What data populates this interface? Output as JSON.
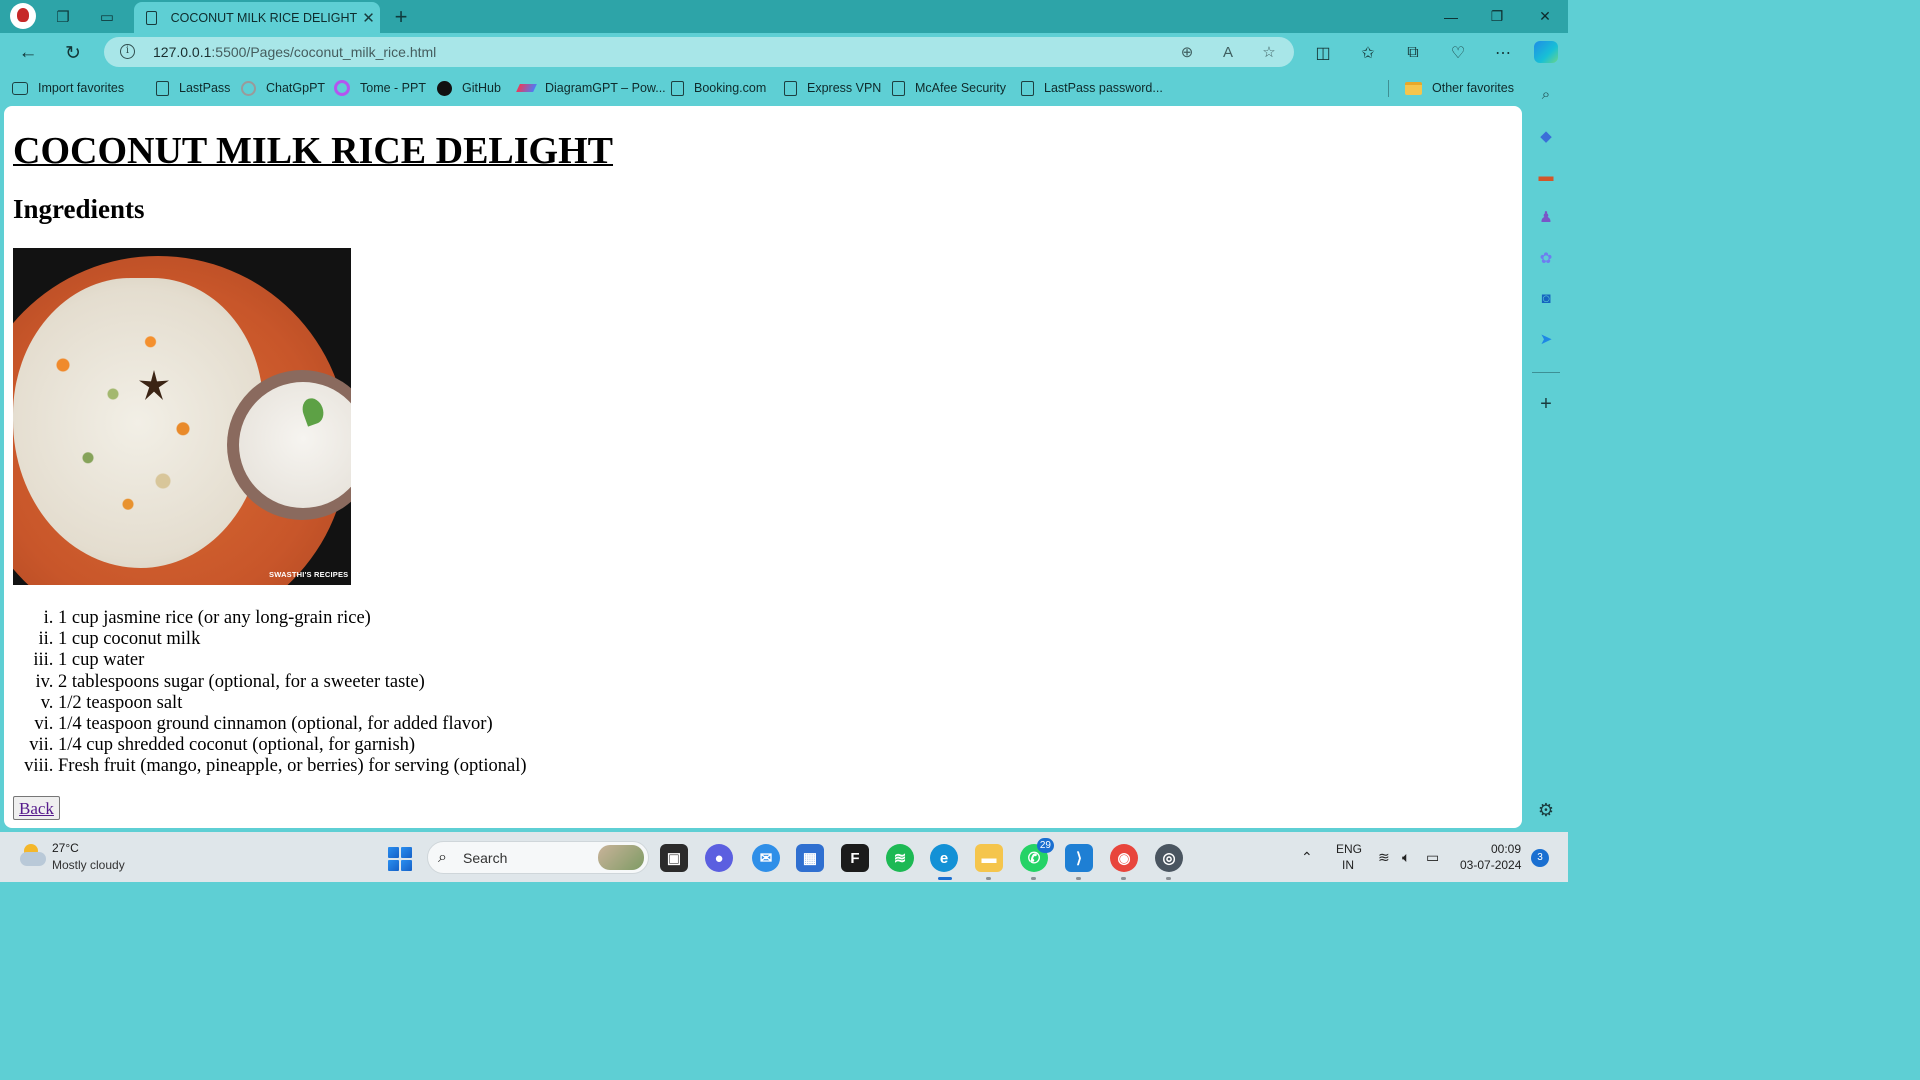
{
  "browser": {
    "tab": {
      "title": "COCONUT MILK RICE DELIGHT"
    },
    "address": {
      "url_host": "127.0.0.1",
      "url_rest": ":5500/Pages/coconut_milk_rice.html"
    },
    "favorites": [
      {
        "label": "Import favorites",
        "icon": "import-icon"
      },
      {
        "label": "LastPass",
        "icon": "page-icon"
      },
      {
        "label": "ChatGpPT",
        "icon": "chatgpt-icon"
      },
      {
        "label": "Tome - PPT",
        "icon": "tome-icon"
      },
      {
        "label": "GitHub",
        "icon": "github-icon"
      },
      {
        "label": "DiagramGPT – Pow...",
        "icon": "diagramgpt-icon"
      },
      {
        "label": "Booking.com",
        "icon": "page-icon"
      },
      {
        "label": "Express VPN",
        "icon": "page-icon"
      },
      {
        "label": "McAfee Security",
        "icon": "page-icon"
      },
      {
        "label": "LastPass password...",
        "icon": "page-icon"
      }
    ],
    "other_favorites": "Other favorites"
  },
  "page": {
    "heading": "COCONUT MILK RICE DELIGHT",
    "subheading": "Ingredients",
    "image_watermark": "SWASTHI'S RECIPES",
    "ingredients": [
      "1 cup jasmine rice (or any long-grain rice)",
      "1 cup coconut milk",
      "1 cup water",
      "2 tablespoons sugar (optional, for a sweeter taste)",
      "1/2 teaspoon salt",
      "1/4 teaspoon ground cinnamon (optional, for added flavor)",
      "1/4 cup shredded coconut (optional, for garnish)",
      "Fresh fruit (mango, pineapple, or berries) for serving (optional)"
    ],
    "back_label": "Back"
  },
  "taskbar": {
    "weather": {
      "temp": "27°C",
      "desc": "Mostly cloudy"
    },
    "search_placeholder": "Search",
    "whatsapp_badge": "29",
    "lang_line1": "ENG",
    "lang_line2": "IN",
    "time": "00:09",
    "date": "03-07-2024",
    "notifications": "3"
  },
  "colors": {
    "titlebar": "#2da4a8",
    "chrome": "#5ecfd4",
    "omnibox": "#a8e6e8",
    "visited_link": "#551a8b"
  }
}
